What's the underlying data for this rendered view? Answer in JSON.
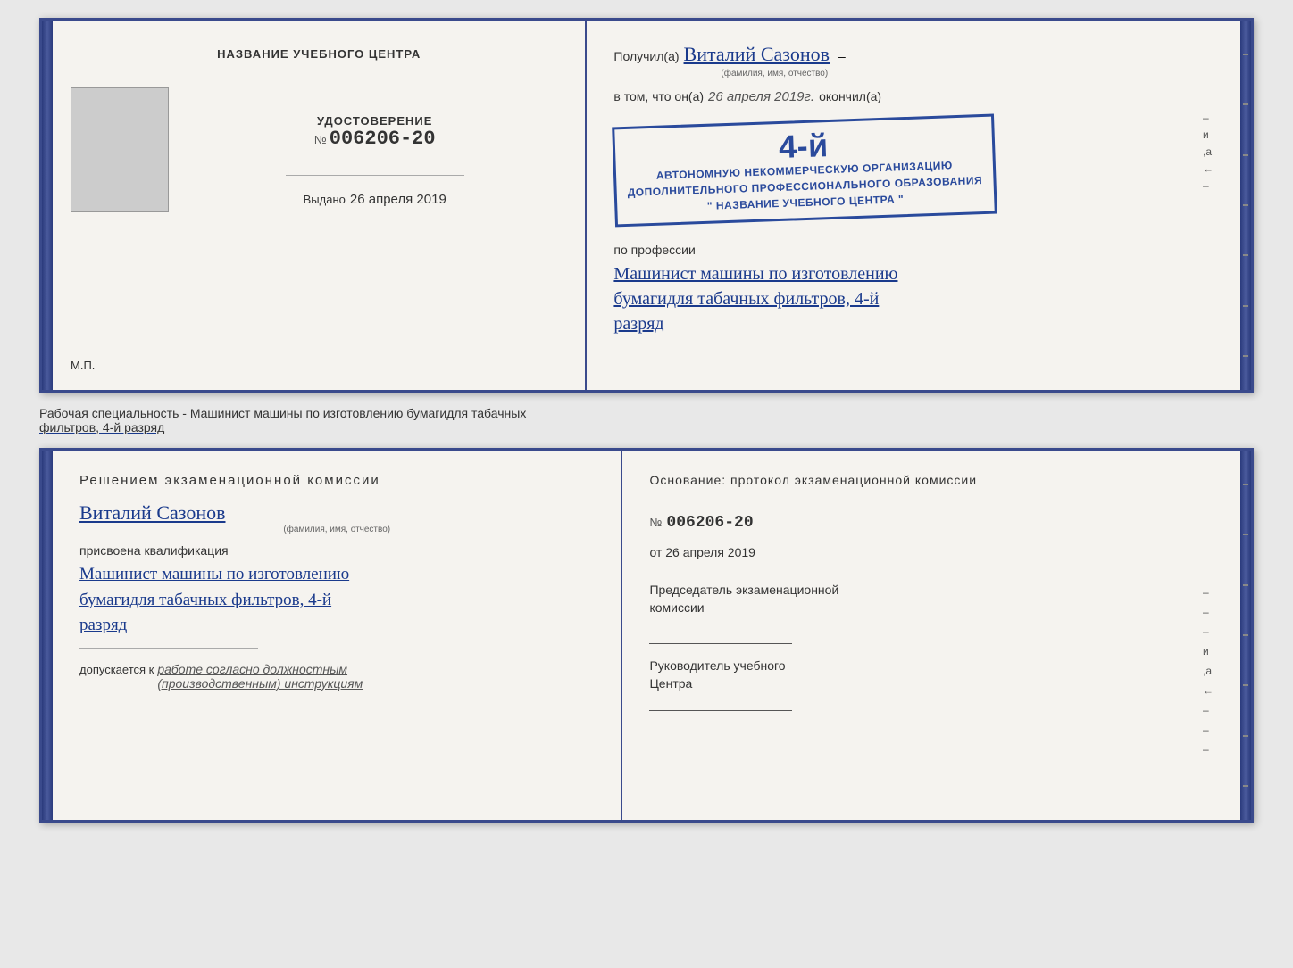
{
  "page": {
    "background": "#e8e8e8"
  },
  "certificate": {
    "left": {
      "title": "НАЗВАНИЕ УЧЕБНОГО ЦЕНТРА",
      "udostoverenie_label": "УДОСТОВЕРЕНИЕ",
      "number_prefix": "№",
      "number": "006206-20",
      "vydano_label": "Выдано",
      "vydano_date": "26 апреля 2019",
      "mp_label": "М.П."
    },
    "right": {
      "poluchil_label": "Получил(а)",
      "recipient_name": "Виталий Сазонов",
      "fio_hint": "(фамилия, имя, отчество)",
      "dash": "–",
      "v_tom_label": "в том, что он(а)",
      "date_handwritten": "26 апреля 2019г.",
      "okonchil_label": "окончил(а)",
      "stamp_num": "4-й",
      "stamp_line1": "АВТОНОМНУЮ НЕКОММЕРЧЕСКУЮ ОРГАНИЗАЦИЮ",
      "stamp_line2": "ДОПОЛНИТЕЛЬНОГО ПРОФЕССИОНАЛЬНОГО ОБРАЗОВАНИЯ",
      "stamp_line3": "\" НАЗВАНИЕ УЧЕБНОГО ЦЕНТРА \"",
      "i_label": "и",
      "a_label": ",а",
      "left_arrow": "←",
      "po_professii_label": "по профессии",
      "profession_line1": "Машинист машины по изготовлению",
      "profession_line2": "бумагидля табачных фильтров, 4-й",
      "profession_line3": "разряд"
    }
  },
  "between": {
    "text_normal": "Рабочая специальность - Машинист машины по изготовлению бумагидля табачных",
    "text_underline": "фильтров, 4-й разряд"
  },
  "commission": {
    "left": {
      "title": "Решением  экзаменационной  комиссии",
      "name_value": "Виталий Сазонов",
      "name_hint": "(фамилия, имя, отчество)",
      "assigned_label": "присвоена квалификация",
      "qual_line1": "Машинист машины по изготовлению",
      "qual_line2": "бумагидля табачных фильтров, 4-й",
      "qual_line3": "разряд",
      "dopusk_label": "допускается к",
      "dopusk_value": "работе согласно должностным",
      "dopusk_value2": "(производственным) инструкциям"
    },
    "right": {
      "osnov_label": "Основание:  протокол  экзаменационной  комиссии",
      "number_prefix": "№",
      "number": "006206-20",
      "date_prefix": "от",
      "date_value": "26 апреля 2019",
      "dash1": "–",
      "dash2": "–",
      "dash3": "–",
      "i_label": "и",
      "a_label": ",а",
      "left_arrow": "←",
      "chair_label": "Председатель экзаменационной",
      "chair_label2": "комиссии",
      "rukov_label": "Руководитель учебного",
      "rukov_label2": "Центра"
    }
  }
}
